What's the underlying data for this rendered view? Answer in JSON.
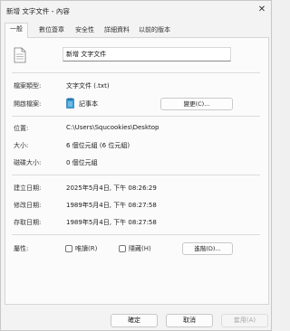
{
  "window": {
    "title": "新增 文字文件 - 內容",
    "close_glyph": "✕"
  },
  "tabs": [
    {
      "label": "一般",
      "active": true
    },
    {
      "label": "數位簽章",
      "active": false
    },
    {
      "label": "安全性",
      "active": false
    },
    {
      "label": "詳細資料",
      "active": false
    },
    {
      "label": "以前的版本",
      "active": false
    }
  ],
  "file": {
    "name": "新增 文字文件",
    "icon": "document-icon"
  },
  "type": {
    "label": "檔案類型:",
    "value": "文字文件 (.txt)"
  },
  "opens_with": {
    "label": "開啟檔案:",
    "app": "記事本",
    "app_icon": "notepad-icon",
    "change_button": "變更(C)..."
  },
  "location": {
    "label": "位置:",
    "value": "C:\\Users\\Squcookies\\Desktop"
  },
  "size": {
    "label": "大小:",
    "value": "6 個位元組 (6 位元組)"
  },
  "size_on_disk": {
    "label": "磁碟大小:",
    "value": "0 個位元組"
  },
  "created": {
    "label": "建立日期:",
    "value": "2025年5月4日, 下午 08:26:29"
  },
  "modified": {
    "label": "修改日期:",
    "value": "1989年5月4日, 下午 08:27:58"
  },
  "accessed": {
    "label": "存取日期:",
    "value": "1989年5月4日, 下午 08:27:58"
  },
  "attributes": {
    "label": "屬性:",
    "readonly": {
      "label": "唯讀(R)",
      "checked": false
    },
    "hidden": {
      "label": "隱藏(H)",
      "checked": false
    },
    "advanced_button": "進階(D)..."
  },
  "footer": {
    "ok": "確定",
    "cancel": "取消",
    "apply": "套用(A)"
  },
  "colors": {
    "accent": "#0067c0",
    "apply_disabled": "#a8a8a8"
  }
}
